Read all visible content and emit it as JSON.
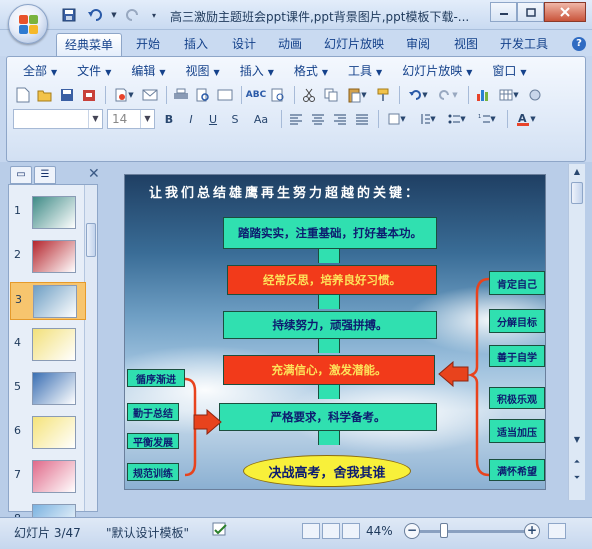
{
  "app": {
    "title": "高三激励主题班会ppt课件,ppt背景图片,ppt模板下载-..."
  },
  "ribbon_tabs": [
    {
      "label": "经典菜单",
      "active": true
    },
    {
      "label": "开始",
      "active": false
    },
    {
      "label": "插入",
      "active": false
    },
    {
      "label": "设计",
      "active": false
    },
    {
      "label": "动画",
      "active": false
    },
    {
      "label": "幻灯片放映",
      "active": false
    },
    {
      "label": "审阅",
      "active": false
    },
    {
      "label": "视图",
      "active": false
    },
    {
      "label": "开发工具",
      "active": false
    }
  ],
  "classic_menu": [
    "全部",
    "文件",
    "编辑",
    "视图",
    "插入",
    "格式",
    "工具",
    "幻灯片放映",
    "窗口"
  ],
  "font_size_combo": "14",
  "format_buttons": [
    "B",
    "I",
    "U",
    "S",
    "Aa"
  ],
  "thumbnails": [
    {
      "num": "1",
      "selected": false,
      "color": "#3f8b87"
    },
    {
      "num": "2",
      "selected": false,
      "color": "#b5252d"
    },
    {
      "num": "3",
      "selected": true,
      "color": "#6f9fc4"
    },
    {
      "num": "4",
      "selected": false,
      "color": "#f2e07a"
    },
    {
      "num": "5",
      "selected": false,
      "color": "#3a6fb3"
    },
    {
      "num": "6",
      "selected": false,
      "color": "#f5e37a"
    },
    {
      "num": "7",
      "selected": false,
      "color": "#e06a8a"
    },
    {
      "num": "8",
      "selected": false,
      "color": "#7bb2e0"
    }
  ],
  "slide": {
    "title": "让我们总结雄鹰再生努力超越的关键：",
    "center_boxes": [
      {
        "text": "踏踏实实，注重基础，打好基本功。",
        "style": "green"
      },
      {
        "text": "经常反思，培养良好习惯。",
        "style": "red"
      },
      {
        "text": "持续努力，顽强拼搏。",
        "style": "green"
      },
      {
        "text": "充满信心，激发潜能。",
        "style": "red"
      },
      {
        "text": "严格要求，科学备考。",
        "style": "green"
      }
    ],
    "left_boxes": [
      "循序渐进",
      "勤于总结",
      "平衡发展",
      "规范训练"
    ],
    "right_boxes": [
      "肯定自己",
      "分解目标",
      "善于自学",
      "积极乐观",
      "适当加压",
      "满怀希望"
    ],
    "goal": "决战高考，舍我其谁"
  },
  "status": {
    "slide_counter": "幻灯片 3/47",
    "theme": "\"默认设计模板\"",
    "zoom": "44%",
    "zoom_level": 0.44
  },
  "colors": {
    "box_green": "#30e0b0",
    "box_red": "#f23a1a",
    "goal_yellow": "#f8f03a",
    "arrow_red": "#e8431d"
  }
}
